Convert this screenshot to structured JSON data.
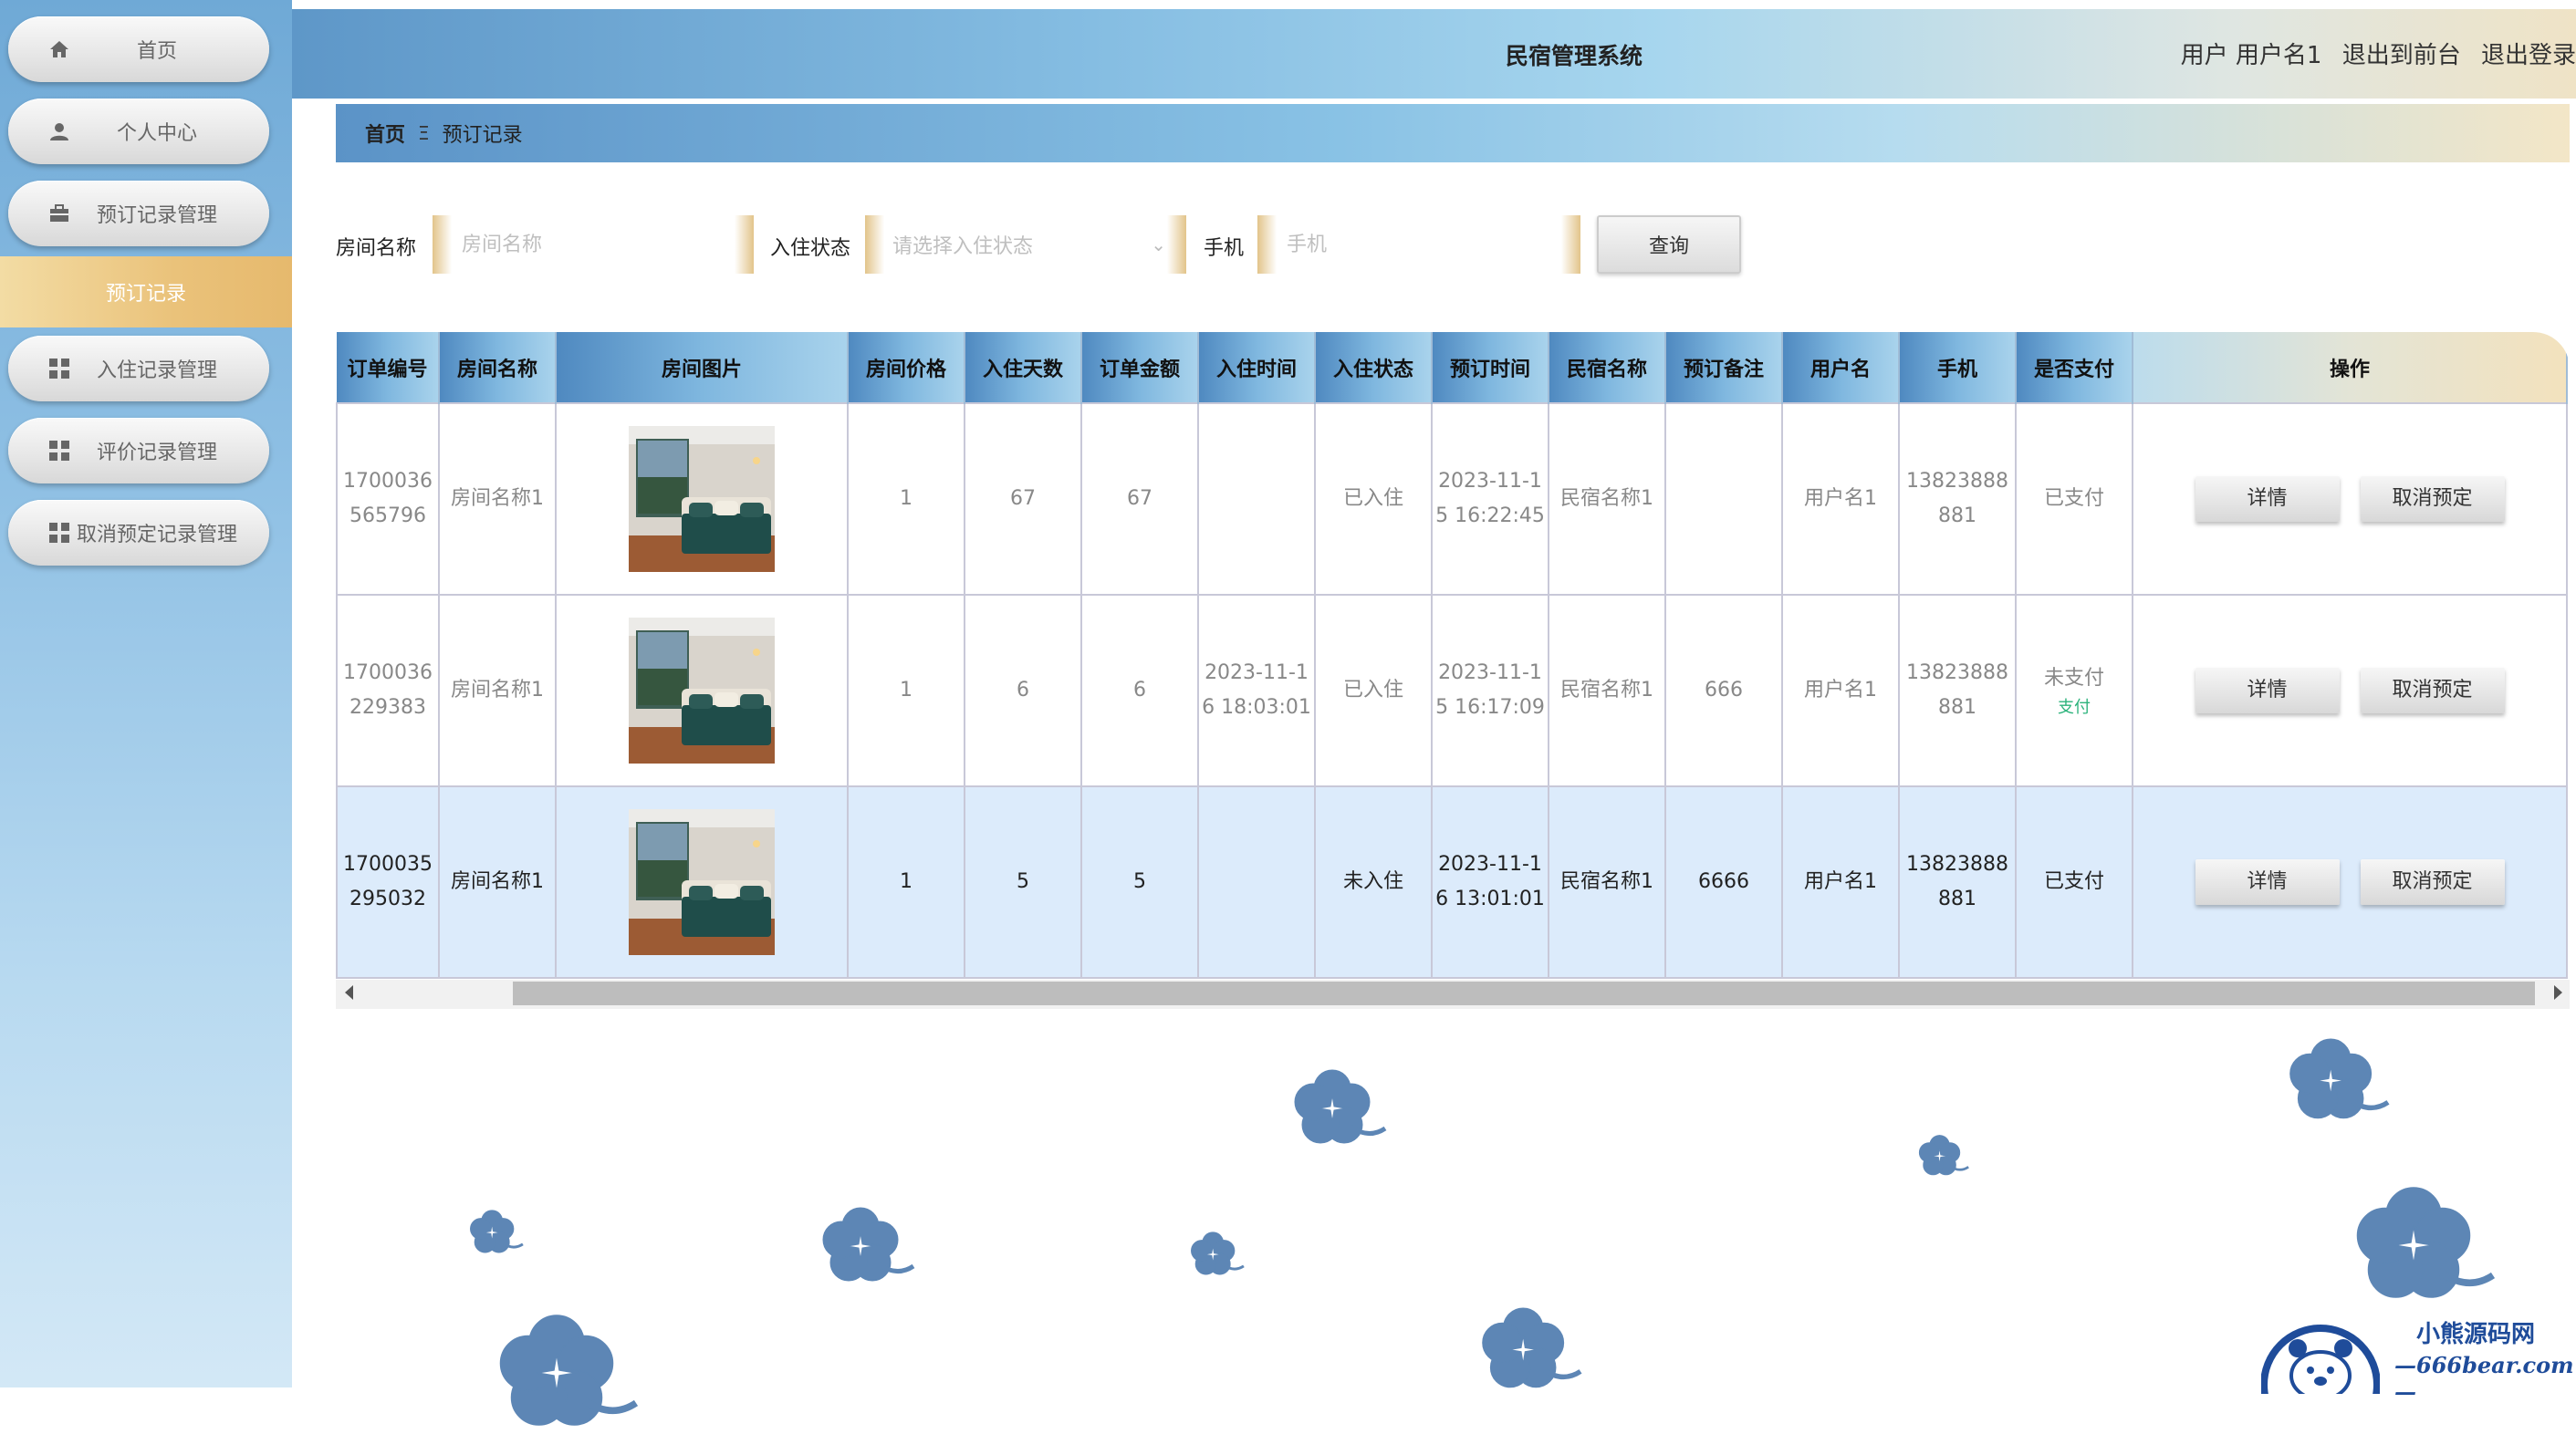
{
  "header": {
    "title": "民宿管理系统",
    "user_label": "用户 用户名1",
    "front_link": "退出到前台",
    "logout_link": "退出登录"
  },
  "sidebar": {
    "items": [
      {
        "label": "首页",
        "icon": "home-icon"
      },
      {
        "label": "个人中心",
        "icon": "person-icon"
      },
      {
        "label": "预订记录管理",
        "icon": "briefcase-icon"
      },
      {
        "label": "入住记录管理",
        "icon": "grid-icon"
      },
      {
        "label": "评价记录管理",
        "icon": "grid-icon"
      },
      {
        "label": "取消预定记录管理",
        "icon": "grid-icon"
      }
    ],
    "active_sub": "预订记录"
  },
  "breadcrumb": {
    "home": "首页",
    "separator": "Ξ",
    "current": "预订记录"
  },
  "search": {
    "room_label": "房间名称",
    "room_placeholder": "房间名称",
    "status_label": "入住状态",
    "status_placeholder": "请选择入住状态",
    "phone_label": "手机",
    "phone_placeholder": "手机",
    "query_button": "查询"
  },
  "table": {
    "headers": [
      "订单编号",
      "房间名称",
      "房间图片",
      "房间价格",
      "入住天数",
      "订单金额",
      "入住时间",
      "入住状态",
      "预订时间",
      "民宿名称",
      "预订备注",
      "用户名",
      "手机",
      "是否支付",
      "操作"
    ],
    "rows": [
      {
        "order_no": "1700036565796",
        "room_name": "房间名称1",
        "price": "1",
        "days": "67",
        "amount": "67",
        "checkin_time": "",
        "status": "已入住",
        "booking_time": "2023-11-15 16:22:45",
        "homestay": "民宿名称1",
        "remark": "",
        "username": "用户名1",
        "phone": "13823888881",
        "paid": "已支付",
        "pay_action": "",
        "highlighted": false
      },
      {
        "order_no": "1700036229383",
        "room_name": "房间名称1",
        "price": "1",
        "days": "6",
        "amount": "6",
        "checkin_time": "2023-11-16 18:03:01",
        "status": "已入住",
        "booking_time": "2023-11-15 16:17:09",
        "homestay": "民宿名称1",
        "remark": "666",
        "username": "用户名1",
        "phone": "13823888881",
        "paid": "未支付",
        "pay_action": "支付",
        "highlighted": false
      },
      {
        "order_no": "1700035295032",
        "room_name": "房间名称1",
        "price": "1",
        "days": "5",
        "amount": "5",
        "checkin_time": "",
        "status": "未入住",
        "booking_time": "2023-11-16 13:01:01",
        "homestay": "民宿名称1",
        "remark": "6666",
        "username": "用户名1",
        "phone": "13823888881",
        "paid": "已支付",
        "pay_action": "",
        "highlighted": true
      }
    ],
    "detail_button": "详情",
    "cancel_button": "取消预定"
  },
  "watermark": {
    "line1": "小熊源码网",
    "line2": "—666bear.com—"
  },
  "colors": {
    "accent_gold": "#eac27a",
    "header_blue": "#5e97c8",
    "flower_blue": "#5d86b5",
    "paid_link": "#2db37c",
    "row_highlight": "#dcebfb"
  }
}
